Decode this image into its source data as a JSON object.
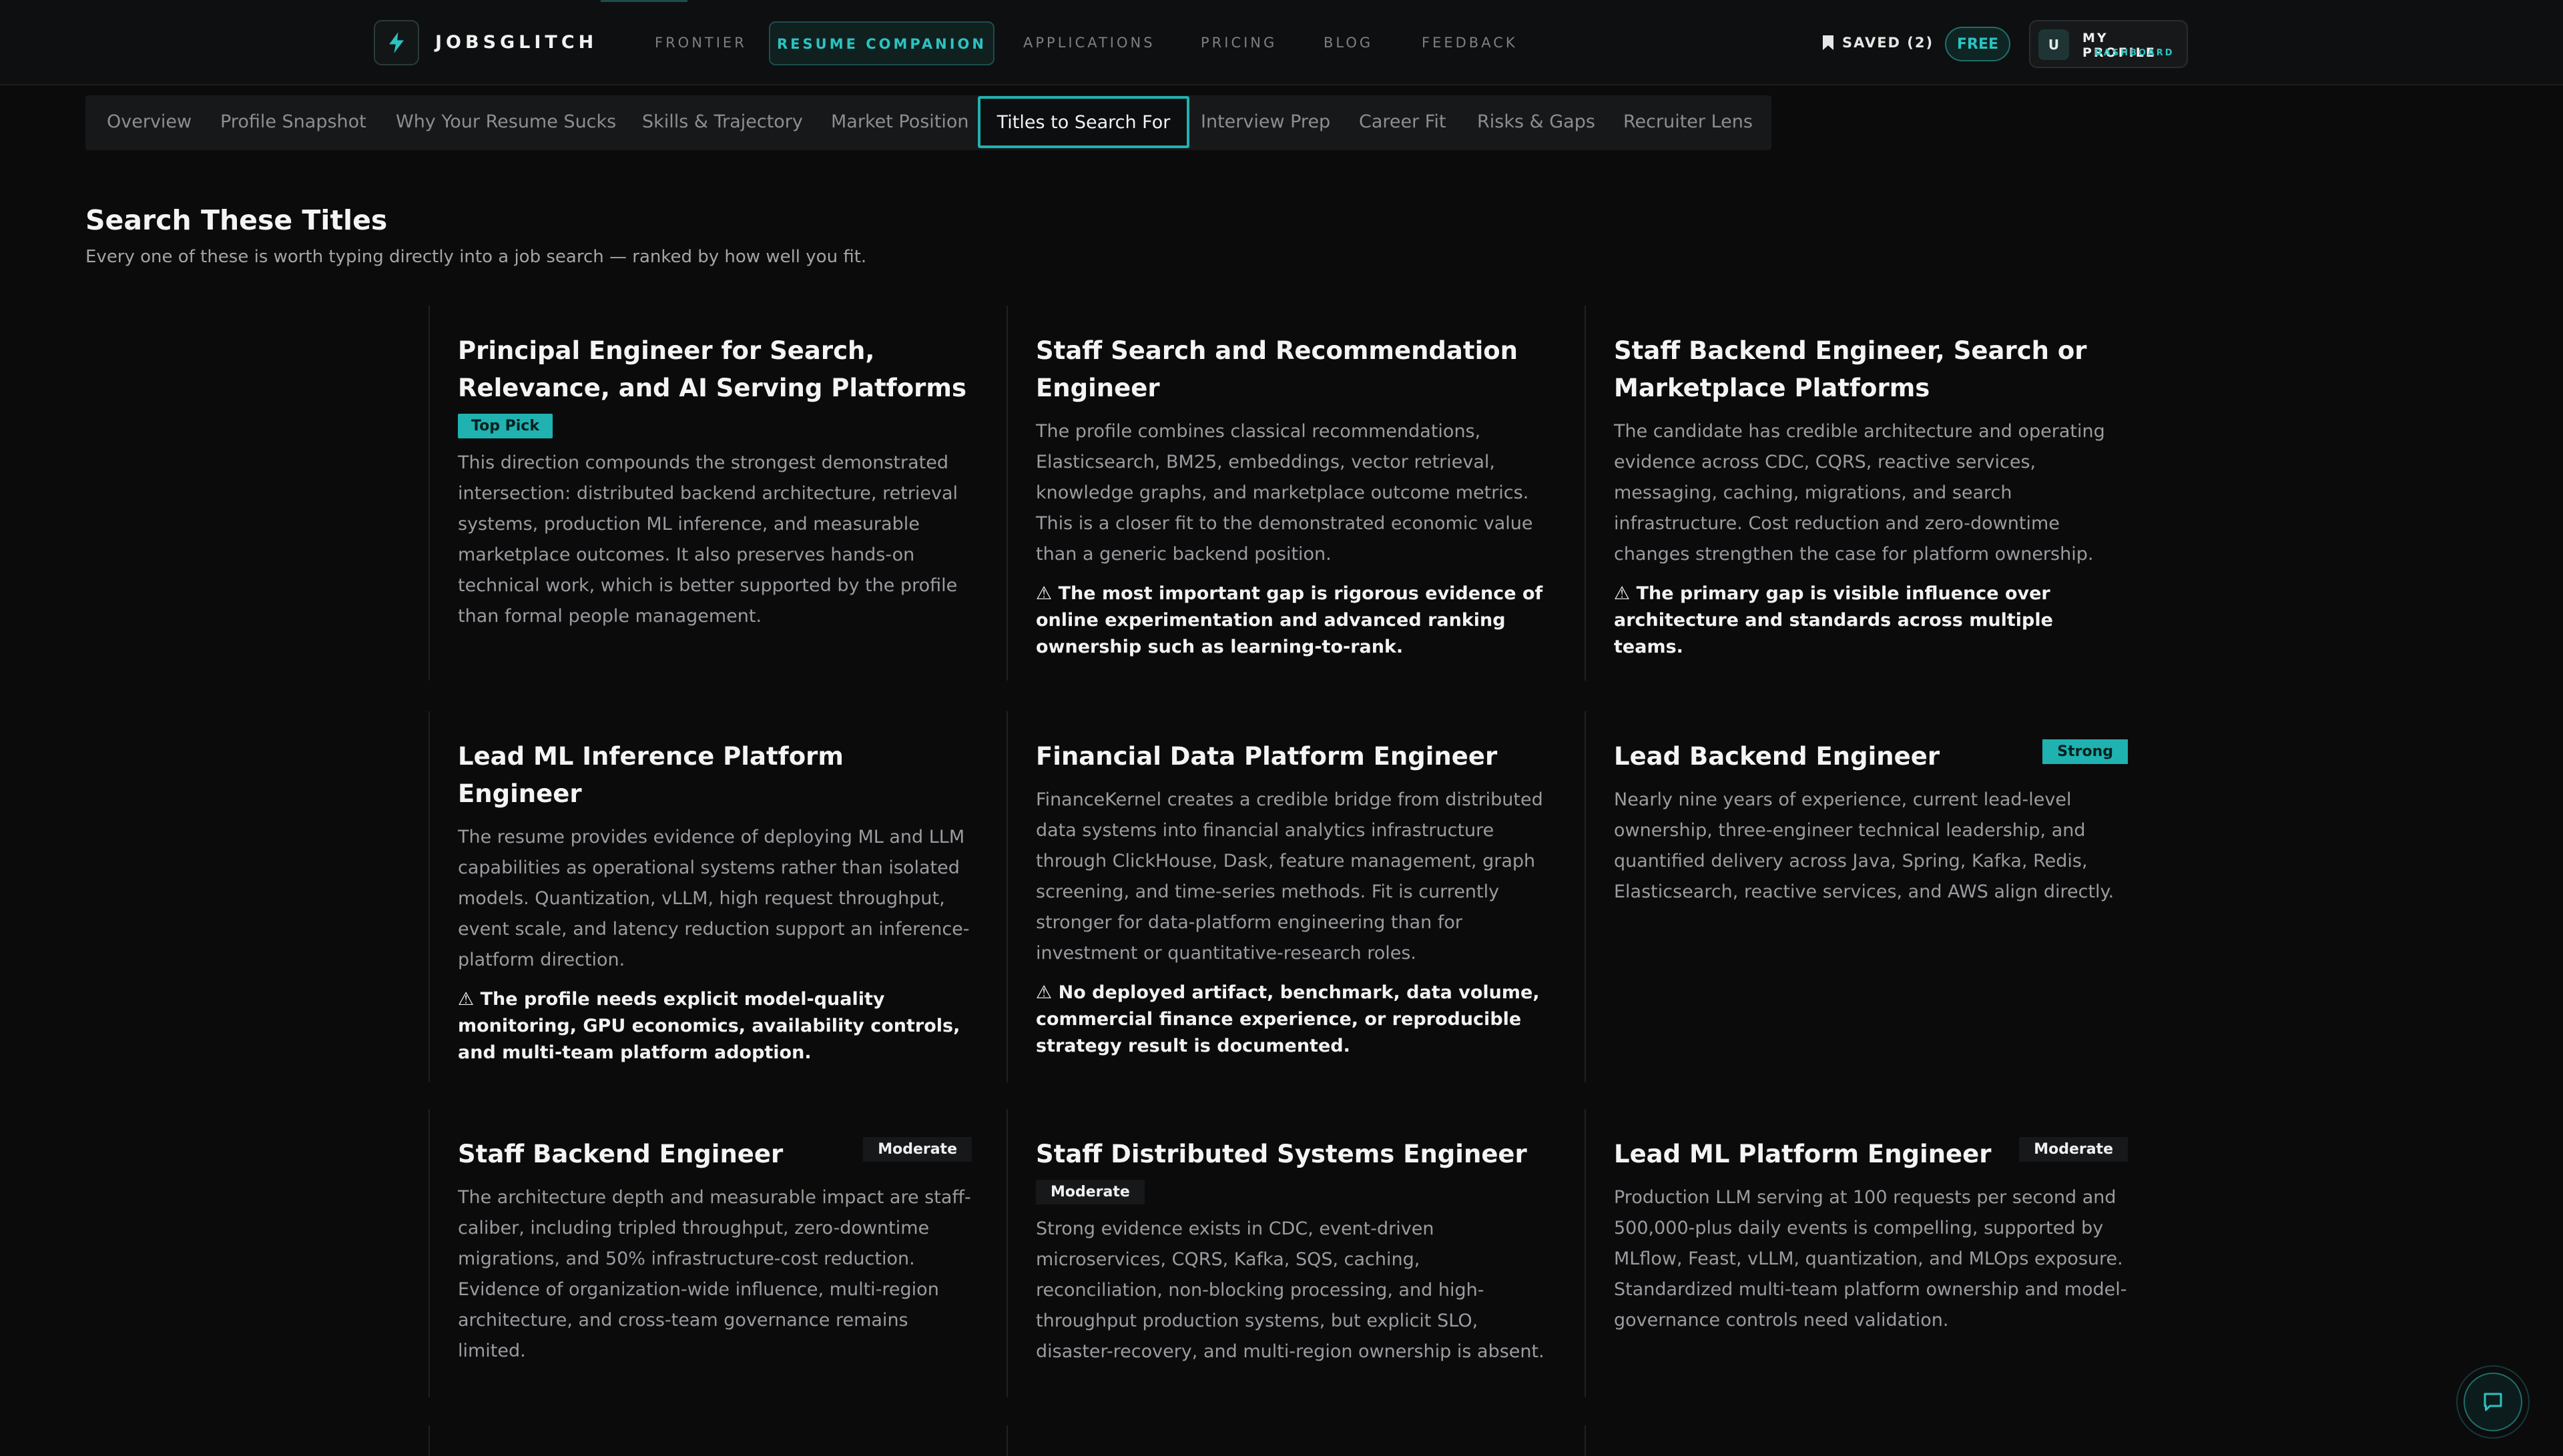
{
  "brand": {
    "name": "JOBSGLITCH"
  },
  "nav": {
    "items": [
      "FRONTIER",
      "RESUME COMPANION",
      "APPLICATIONS",
      "PRICING",
      "BLOG",
      "FEEDBACK"
    ],
    "active": "RESUME COMPANION",
    "saved_label": "SAVED (2)",
    "plan_badge": "FREE",
    "profile": {
      "avatar_initial": "U",
      "title": "MY PROFILE",
      "subtitle": "DASHBOARD"
    }
  },
  "subtabs": {
    "items": [
      "Overview",
      "Profile Snapshot",
      "Why Your Resume Sucks",
      "Skills & Trajectory",
      "Market Position",
      "Titles to Search For",
      "Interview Prep",
      "Career Fit",
      "Risks & Gaps",
      "Recruiter Lens"
    ],
    "active": "Titles to Search For"
  },
  "section": {
    "title": "Search These Titles",
    "subtitle": "Every one of these is worth typing directly into a job search — ranked by how well you fit."
  },
  "cards": [
    {
      "title": "Principal Engineer for Search, Relevance, and AI Serving Platforms",
      "badge": "Top Pick",
      "body": "This direction compounds the strongest demonstrated intersection: distributed backend architecture, retrieval systems, production ML inference, and measurable marketplace outcomes. It also preserves hands-on technical work, which is better supported by the profile than formal people management.",
      "gap": ""
    },
    {
      "title": "Staff Search and Recommendation Engineer",
      "badge": "",
      "body": "The profile combines classical recommendations, Elasticsearch, BM25, embeddings, vector retrieval, knowledge graphs, and marketplace outcome metrics. This is a closer fit to the demonstrated economic value than a generic backend position.",
      "gap": "⚠ The most important gap is rigorous evidence of online experimentation and advanced ranking ownership such as learning-to-rank."
    },
    {
      "title": "Staff Backend Engineer, Search or Marketplace Platforms",
      "badge": "",
      "body": "The candidate has credible architecture and operating evidence across CDC, CQRS, reactive services, messaging, caching, migrations, and search infrastructure. Cost reduction and zero-downtime changes strengthen the case for platform ownership.",
      "gap": "⚠ The primary gap is visible influence over architecture and standards across multiple teams."
    },
    {
      "title": "Lead ML Inference Platform Engineer",
      "badge": "",
      "body": "The resume provides evidence of deploying ML and LLM capabilities as operational systems rather than isolated models. Quantization, vLLM, high request throughput, event scale, and latency reduction support an inference-platform direction.",
      "gap": "⚠ The profile needs explicit model-quality monitoring, GPU economics, availability controls, and multi-team platform adoption."
    },
    {
      "title": "Financial Data Platform Engineer",
      "badge": "",
      "body": "FinanceKernel creates a credible bridge from distributed data systems into financial analytics infrastructure through ClickHouse, Dask, feature management, graph screening, and time-series methods. Fit is currently stronger for data-platform engineering than for investment or quantitative-research roles.",
      "gap": "⚠ No deployed artifact, benchmark, data volume, commercial finance experience, or reproducible strategy result is documented."
    },
    {
      "title": "Lead Backend Engineer",
      "badge": "Strong",
      "body": "Nearly nine years of experience, current lead-level ownership, three-engineer technical leadership, and quantified delivery across Java, Spring, Kafka, Redis, Elasticsearch, reactive services, and AWS align directly.",
      "gap": ""
    },
    {
      "title": "Staff Backend Engineer",
      "badge": "Moderate",
      "body": "The architecture depth and measurable impact are staff-caliber, including tripled throughput, zero-downtime migrations, and 50% infrastructure-cost reduction. Evidence of organization-wide influence, multi-region architecture, and cross-team governance remains limited.",
      "gap": ""
    },
    {
      "title": "Staff Distributed Systems Engineer",
      "badge": "Moderate",
      "body": "Strong evidence exists in CDC, event-driven microservices, CQRS, Kafka, SQS, caching, reconciliation, non-blocking processing, and high-throughput production systems, but explicit SLO, disaster-recovery, and multi-region ownership is absent.",
      "gap": ""
    },
    {
      "title": "Lead ML Platform Engineer",
      "badge": "Moderate",
      "body": "Production LLM serving at 100 requests per second and 500,000-plus daily events is compelling, supported by MLflow, Feast, vLLM, quantization, and MLOps exposure. Standardized multi-team platform ownership and model-governance controls need validation.",
      "gap": ""
    }
  ],
  "colors": {
    "accent": "#1fb2b0",
    "background": "#0b0b0c",
    "muted_text": "#9a9c9f"
  },
  "icons": [
    "bolt-icon",
    "bookmark-icon",
    "chat-icon",
    "warning-icon"
  ]
}
